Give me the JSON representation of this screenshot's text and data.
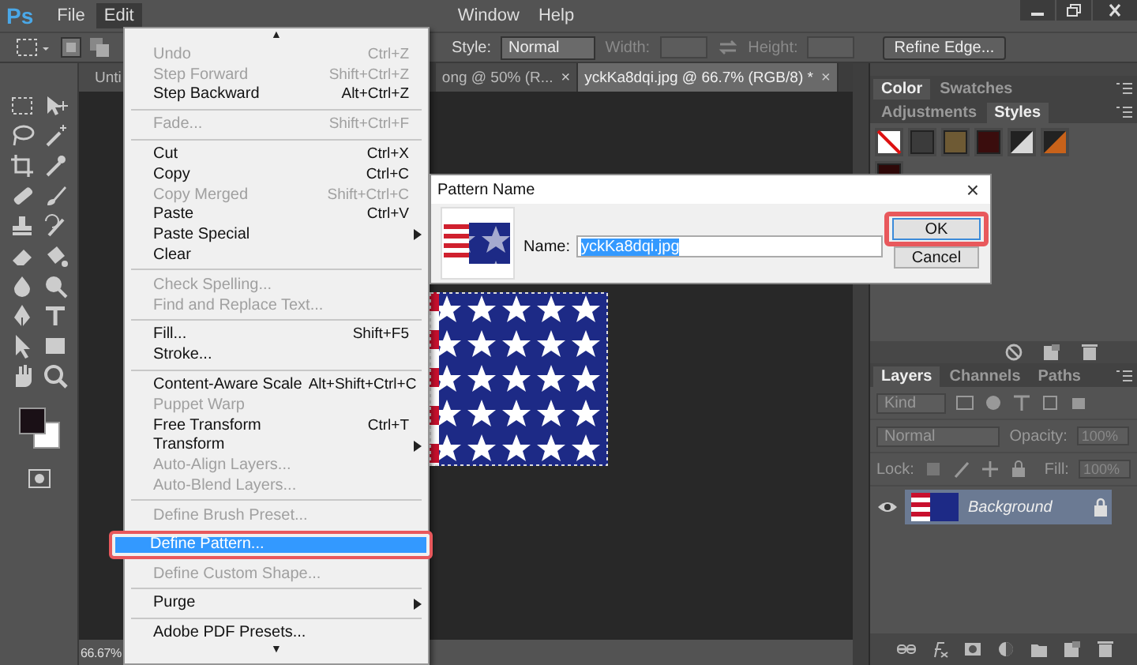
{
  "app": {
    "logo": "Ps"
  },
  "menubar": [
    {
      "label": "File",
      "selected": false
    },
    {
      "label": "Edit",
      "selected": true
    },
    {
      "label": "Window",
      "selected": false
    },
    {
      "label": "Help",
      "selected": false
    }
  ],
  "options_bar": {
    "style_label": "Style:",
    "style_value": "Normal",
    "width_label": "Width:",
    "height_label": "Height:",
    "refine_button": "Refine Edge..."
  },
  "document_tabs": [
    {
      "label": "Unti",
      "selected": false
    },
    {
      "label": "ong @ 50% (R...",
      "selected": false,
      "close": "×"
    },
    {
      "label": "yckKa8dqi.jpg @ 66.7% (RGB/8) *",
      "selected": true,
      "close": "×"
    }
  ],
  "status_bar": {
    "zoom": "66.67%"
  },
  "edit_menu": {
    "items": [
      {
        "kind": "scroll",
        "label": "▲"
      },
      {
        "kind": "item",
        "label": "Undo",
        "shortcut": "Ctrl+Z",
        "disabled": true,
        "submenu": false,
        "selected": false,
        "highlighted": false
      },
      {
        "kind": "item",
        "label": "Step Forward",
        "shortcut": "Shift+Ctrl+Z",
        "disabled": true,
        "submenu": false,
        "selected": false,
        "highlighted": false
      },
      {
        "kind": "item",
        "label": "Step Backward",
        "shortcut": "Alt+Ctrl+Z",
        "disabled": false,
        "submenu": false,
        "selected": false,
        "highlighted": false
      },
      {
        "kind": "separator"
      },
      {
        "kind": "item",
        "label": "Fade...",
        "shortcut": "Shift+Ctrl+F",
        "disabled": true,
        "submenu": false,
        "selected": false,
        "highlighted": false
      },
      {
        "kind": "separator"
      },
      {
        "kind": "item",
        "label": "Cut",
        "shortcut": "Ctrl+X",
        "disabled": false,
        "submenu": false,
        "selected": false,
        "highlighted": false
      },
      {
        "kind": "item",
        "label": "Copy",
        "shortcut": "Ctrl+C",
        "disabled": false,
        "submenu": false,
        "selected": false,
        "highlighted": false
      },
      {
        "kind": "item",
        "label": "Copy Merged",
        "shortcut": "Shift+Ctrl+C",
        "disabled": true,
        "submenu": false,
        "selected": false,
        "highlighted": false
      },
      {
        "kind": "item",
        "label": "Paste",
        "shortcut": "Ctrl+V",
        "disabled": false,
        "submenu": false,
        "selected": false,
        "highlighted": false
      },
      {
        "kind": "item",
        "label": "Paste Special",
        "disabled": false,
        "submenu": true,
        "selected": false,
        "highlighted": false
      },
      {
        "kind": "item",
        "label": "Clear",
        "disabled": false,
        "submenu": false,
        "selected": false,
        "highlighted": false
      },
      {
        "kind": "separator"
      },
      {
        "kind": "item",
        "label": "Check Spelling...",
        "disabled": true,
        "submenu": false,
        "selected": false,
        "highlighted": false
      },
      {
        "kind": "item",
        "label": "Find and Replace Text...",
        "disabled": true,
        "submenu": false,
        "selected": false,
        "highlighted": false
      },
      {
        "kind": "separator"
      },
      {
        "kind": "item",
        "label": "Fill...",
        "shortcut": "Shift+F5",
        "disabled": false,
        "submenu": false,
        "selected": false,
        "highlighted": false
      },
      {
        "kind": "item",
        "label": "Stroke...",
        "disabled": false,
        "submenu": false,
        "selected": false,
        "highlighted": false
      },
      {
        "kind": "separator"
      },
      {
        "kind": "item",
        "label": "Content-Aware Scale",
        "shortcut": "Alt+Shift+Ctrl+C",
        "disabled": false,
        "submenu": false,
        "selected": false,
        "highlighted": false
      },
      {
        "kind": "item",
        "label": "Puppet Warp",
        "disabled": true,
        "submenu": false,
        "selected": false,
        "highlighted": false
      },
      {
        "kind": "item",
        "label": "Free Transform",
        "shortcut": "Ctrl+T",
        "disabled": false,
        "submenu": false,
        "selected": false,
        "highlighted": false
      },
      {
        "kind": "item",
        "label": "Transform",
        "disabled": false,
        "submenu": true,
        "selected": false,
        "highlighted": false
      },
      {
        "kind": "item",
        "label": "Auto-Align Layers...",
        "disabled": true,
        "submenu": false,
        "selected": false,
        "highlighted": false
      },
      {
        "kind": "item",
        "label": "Auto-Blend Layers...",
        "disabled": true,
        "submenu": false,
        "selected": false,
        "highlighted": false
      },
      {
        "kind": "separator"
      },
      {
        "kind": "item",
        "label": "Define Brush Preset...",
        "disabled": true,
        "submenu": false,
        "selected": false,
        "highlighted": false
      },
      {
        "kind": "item",
        "label": "Define Pattern...",
        "disabled": false,
        "submenu": false,
        "selected": true,
        "highlighted": true
      },
      {
        "kind": "item",
        "label": "Define Custom Shape...",
        "disabled": true,
        "submenu": false,
        "selected": false,
        "highlighted": false
      },
      {
        "kind": "separator"
      },
      {
        "kind": "item",
        "label": "Purge",
        "disabled": false,
        "submenu": true,
        "selected": false,
        "highlighted": false
      },
      {
        "kind": "separator"
      },
      {
        "kind": "item",
        "label": "Adobe PDF Presets...",
        "disabled": false,
        "submenu": false,
        "selected": false,
        "highlighted": false
      },
      {
        "kind": "scroll",
        "label": "▼"
      }
    ]
  },
  "dialog": {
    "title": "Pattern Name",
    "close": "×",
    "name_label": "Name:",
    "name_value": "yckKa8dqi.jpg",
    "value_selected": true,
    "buttons": [
      {
        "label": "OK",
        "default": true,
        "highlighted": true
      },
      {
        "label": "Cancel",
        "default": false,
        "highlighted": false
      }
    ]
  },
  "color_panel": {
    "tabs": [
      {
        "label": "Color",
        "selected": true
      },
      {
        "label": "Swatches",
        "selected": false
      }
    ]
  },
  "styles_panel": {
    "tabs": [
      {
        "label": "Adjustments",
        "selected": false
      },
      {
        "label": "Styles",
        "selected": true
      }
    ],
    "styles": [
      {
        "kind": "none"
      },
      {
        "kind": "swatch",
        "color": "#3b3b3b"
      },
      {
        "kind": "swatch",
        "color": "#6e5a34"
      },
      {
        "kind": "swatch",
        "color": "#3a0d0d"
      },
      {
        "kind": "diagonal",
        "color": "#d8d8d8"
      },
      {
        "kind": "diagonal",
        "color": "#c8621a"
      },
      {
        "kind": "swatch",
        "color": "#2e0808"
      }
    ]
  },
  "layers_panel": {
    "tabs": [
      {
        "label": "Layers",
        "selected": true
      },
      {
        "label": "Channels",
        "selected": false
      },
      {
        "label": "Paths",
        "selected": false
      }
    ],
    "filter": "Kind",
    "blend_mode": "Normal",
    "opacity_label": "Opacity:",
    "opacity": "100%",
    "lock_label": "Lock:",
    "fill_label": "Fill:",
    "fill": "100%",
    "layers": [
      {
        "name": "Background",
        "selected": true,
        "visible": true,
        "locked": true
      }
    ]
  }
}
